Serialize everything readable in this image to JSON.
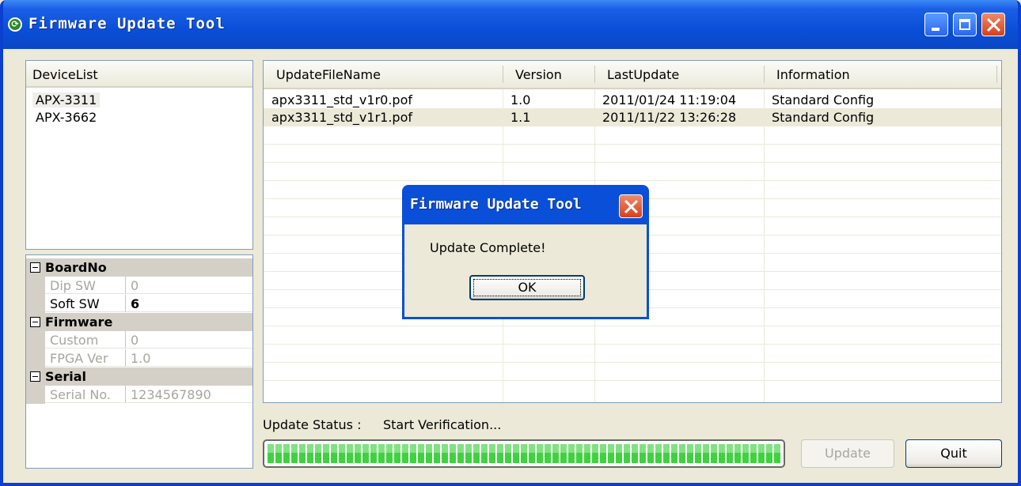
{
  "window": {
    "title": "Firmware Update Tool"
  },
  "device_list": {
    "header": "DeviceList",
    "items": [
      "APX-3311",
      "APX-3662"
    ]
  },
  "properties": {
    "categories": [
      {
        "name": "BoardNo",
        "rows": [
          {
            "label": "Dip SW",
            "value": "0"
          },
          {
            "label": "Soft SW",
            "value": "6"
          }
        ]
      },
      {
        "name": "Firmware",
        "rows": [
          {
            "label": "Custom",
            "value": "0"
          },
          {
            "label": "FPGA Ver",
            "value": "1.0"
          }
        ]
      },
      {
        "name": "Serial",
        "rows": [
          {
            "label": "Serial No.",
            "value": "1234567890"
          }
        ]
      }
    ]
  },
  "file_list": {
    "columns": [
      "UpdateFileName",
      "Version",
      "LastUpdate",
      "Information"
    ],
    "rows": [
      [
        "apx3311_std_v1r0.pof",
        "1.0",
        "2011/01/24 11:19:04",
        "Standard Config"
      ],
      [
        "apx3311_std_v1r1.pof",
        "1.1",
        "2011/11/22 13:26:28",
        "Standard Config"
      ]
    ]
  },
  "status": {
    "label": "Update Status :",
    "value": "Start Verification..."
  },
  "progress": {
    "percent": 100,
    "color": "#3fd23f"
  },
  "buttons": {
    "update": "Update",
    "quit": "Quit"
  },
  "dialog": {
    "title": "Firmware Update Tool",
    "message": "Update Complete!",
    "ok": "OK"
  },
  "colors": {
    "titlebar": "#0a4fd8",
    "face": "#ECE9D8",
    "selected_row": "#ece9d8"
  }
}
